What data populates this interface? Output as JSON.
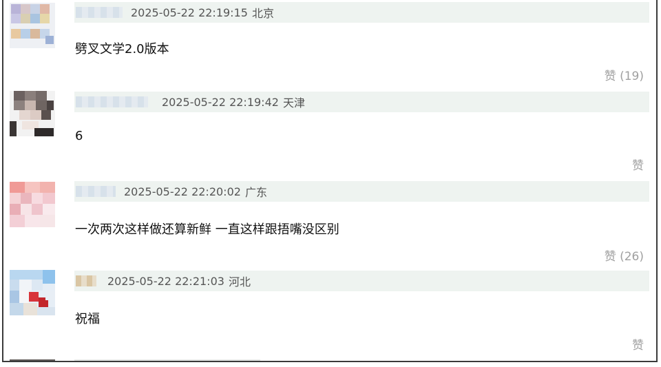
{
  "comments": [
    {
      "timestamp": "2025-05-22 22:19:15",
      "location": "北京",
      "text": "劈叉文学2.0版本",
      "like_label": "赞 (19)"
    },
    {
      "timestamp": "2025-05-22 22:19:42",
      "location": "天津",
      "text": "6",
      "like_label": "赞"
    },
    {
      "timestamp": "2025-05-22 22:20:02",
      "location": "广东",
      "text": "一次两次这样做还算新鲜 一直这样跟捂嘴没区别",
      "like_label": "赞 (26)"
    },
    {
      "timestamp": "2025-05-22 22:21:03",
      "location": "河北",
      "text": "祝福",
      "like_label": "赞"
    }
  ]
}
